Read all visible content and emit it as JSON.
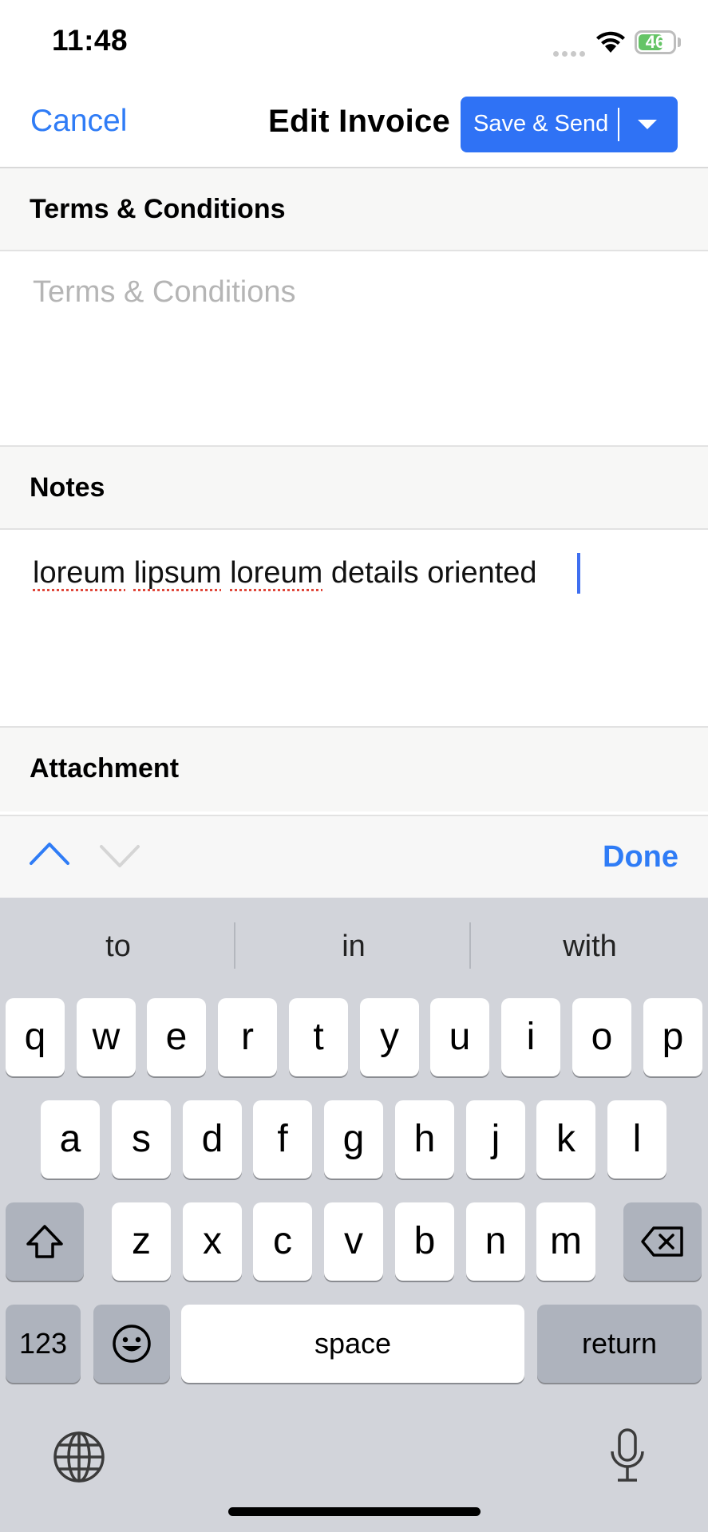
{
  "status_bar": {
    "time": "11:48",
    "battery": "46",
    "battery_color": "#65c466"
  },
  "nav": {
    "cancel": "Cancel",
    "title": "Edit Invoice",
    "save_send": "Save & Send",
    "accent_color": "#2f7cf6"
  },
  "sections": {
    "terms_header": "Terms & Conditions",
    "terms_placeholder": "Terms & Conditions",
    "notes_header": "Notes",
    "notes_words": [
      "loreum",
      "lipsum",
      "loreum",
      "details oriented"
    ],
    "attachment_header": "Attachment"
  },
  "accessory": {
    "done": "Done",
    "prev_icon": "chevron-up-icon",
    "next_icon": "chevron-down-icon"
  },
  "keyboard": {
    "suggestions": [
      "to",
      "in",
      "with"
    ],
    "row1": [
      "q",
      "w",
      "e",
      "r",
      "t",
      "y",
      "u",
      "i",
      "o",
      "p"
    ],
    "row2": [
      "a",
      "s",
      "d",
      "f",
      "g",
      "h",
      "j",
      "k",
      "l"
    ],
    "row3": [
      "z",
      "x",
      "c",
      "v",
      "b",
      "n",
      "m"
    ],
    "numbers": "123",
    "space": "space",
    "return": "return"
  }
}
